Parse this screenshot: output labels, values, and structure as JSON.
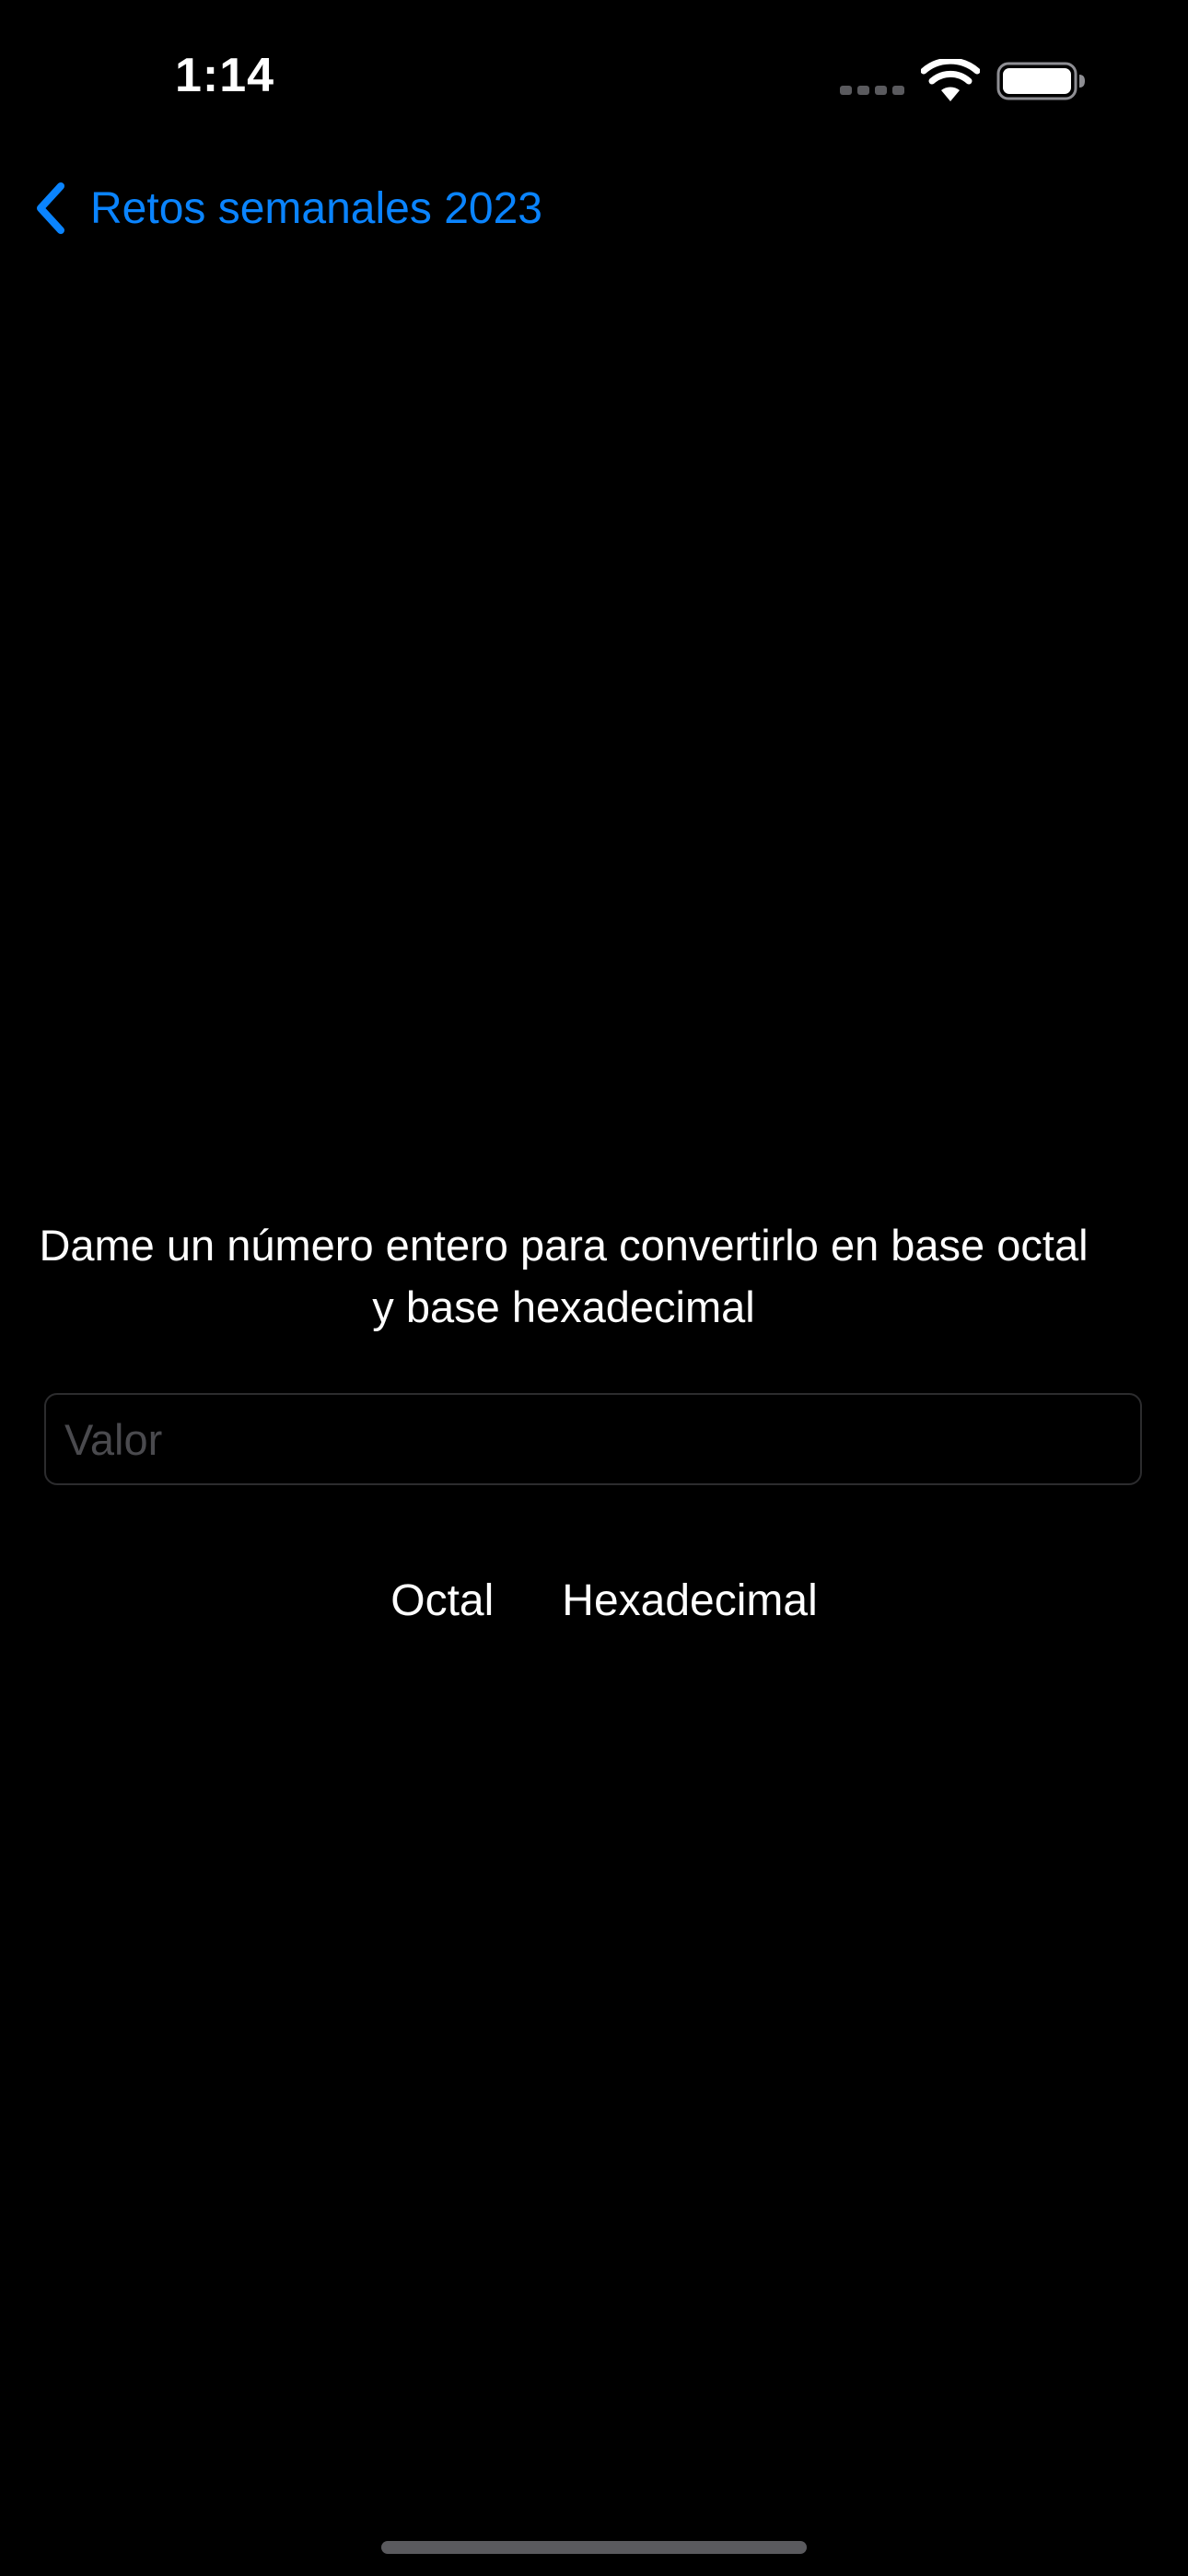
{
  "status_bar": {
    "time": "1:14",
    "icons": [
      "signal-dots-icon",
      "wifi-icon",
      "battery-icon"
    ]
  },
  "nav": {
    "back_label": "Retos semanales 2023",
    "back_icon": "chevron-left-icon"
  },
  "main": {
    "prompt": "Dame un número entero para convertirlo en base octal y base hexadecimal",
    "input": {
      "placeholder": "Valor",
      "value": ""
    },
    "buttons": {
      "octal_label": "Octal",
      "hex_label": "Hexadecimal"
    }
  },
  "colors": {
    "background": "#000000",
    "accent": "#0a84ff",
    "text": "#ffffff",
    "placeholder": "#4a4a4e"
  }
}
